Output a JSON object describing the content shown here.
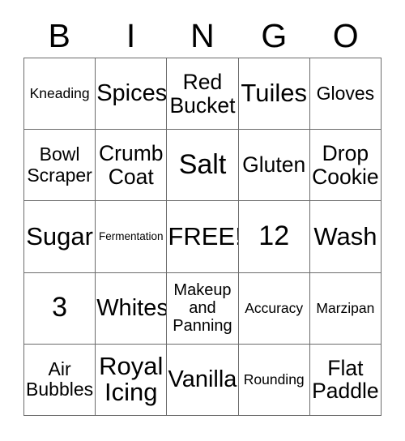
{
  "card": {
    "type": "bingo-card",
    "columns": 5,
    "rows": 5,
    "colors": {
      "background": "#ffffff",
      "text": "#000000",
      "border": "#6b6b6b"
    },
    "headers": [
      "B",
      "I",
      "N",
      "G",
      "O"
    ],
    "cells": [
      [
        {
          "text": "Kneading",
          "size": "sm"
        },
        {
          "text": "Spices",
          "size": "2xl"
        },
        {
          "text": "Red\nBucket",
          "size": "xl"
        },
        {
          "text": "Tuiles",
          "size": "3xl"
        },
        {
          "text": "Gloves",
          "size": "lg"
        }
      ],
      [
        {
          "text": "Bowl\nScraper",
          "size": "lg"
        },
        {
          "text": "Crumb\nCoat",
          "size": "xl"
        },
        {
          "text": "Salt",
          "size": "4xl"
        },
        {
          "text": "Gluten",
          "size": "xl"
        },
        {
          "text": "Drop\nCookie",
          "size": "xl"
        }
      ],
      [
        {
          "text": "Sugar",
          "size": "3xl"
        },
        {
          "text": "Fermentation",
          "size": "xs"
        },
        {
          "text": "FREE!",
          "size": "3xl"
        },
        {
          "text": "12",
          "size": "4xl"
        },
        {
          "text": "Wash",
          "size": "3xl"
        }
      ],
      [
        {
          "text": "3",
          "size": "4xl"
        },
        {
          "text": "Whites",
          "size": "2xl"
        },
        {
          "text": "Makeup\nand\nPanning",
          "size": "md"
        },
        {
          "text": "Accuracy",
          "size": "sm"
        },
        {
          "text": "Marzipan",
          "size": "sm"
        }
      ],
      [
        {
          "text": "Air\nBubbles",
          "size": "lg"
        },
        {
          "text": "Royal\nIcing",
          "size": "3xl"
        },
        {
          "text": "Vanilla",
          "size": "2xl"
        },
        {
          "text": "Rounding",
          "size": "sm"
        },
        {
          "text": "Flat\nPaddle",
          "size": "xl"
        }
      ]
    ]
  }
}
